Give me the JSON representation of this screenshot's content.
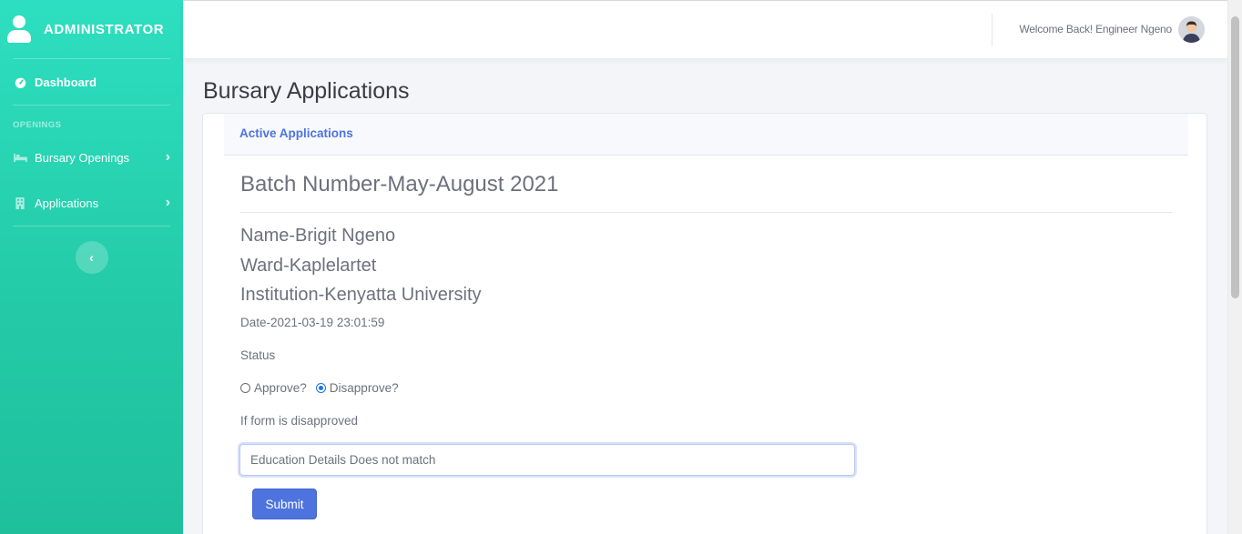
{
  "sidebar": {
    "brand": "ADMINISTRATOR",
    "dashboard_label": "Dashboard",
    "section_heading": "OPENINGS",
    "items": [
      {
        "label": "Bursary Openings",
        "icon": "bed-icon"
      },
      {
        "label": "Applications",
        "icon": "building-icon"
      }
    ],
    "toggle_icon": "chevron-left-icon"
  },
  "topbar": {
    "welcome": "Welcome Back! Engineer Ngeno",
    "avatar": "user-avatar"
  },
  "page": {
    "title": "Bursary Applications"
  },
  "card": {
    "header_tab": "Active Applications",
    "batch": "Batch Number-May-August 2021",
    "name": "Name-Brigit Ngeno",
    "ward": "Ward-Kaplelartet",
    "institution": "Institution-Kenyatta University",
    "date": "Date-2021-03-19 23:01:59",
    "status_label": "Status",
    "radio_approve": "Approve?",
    "radio_disapprove": "Disapprove?",
    "selected_status": "Disapprove?",
    "reason_label": "If form is disapproved",
    "reason_value": "Education Details Does not match",
    "submit_label": "Submit"
  },
  "colors": {
    "sidebar_top": "#2ddfc0",
    "sidebar_bottom": "#1fbf9c",
    "primary": "#4e73df",
    "text_muted": "#6e707e"
  }
}
